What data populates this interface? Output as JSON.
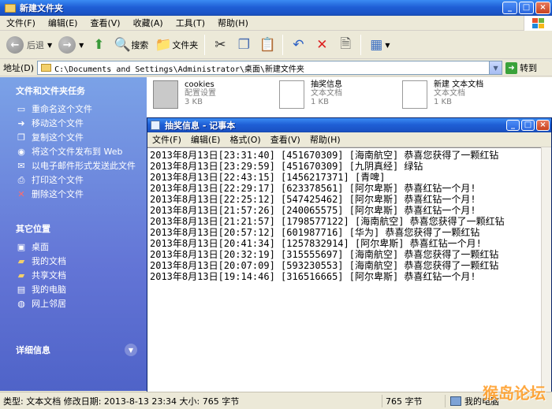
{
  "explorer": {
    "title": "新建文件夹",
    "menu": [
      "文件(F)",
      "编辑(E)",
      "查看(V)",
      "收藏(A)",
      "工具(T)",
      "帮助(H)"
    ],
    "toolbar": {
      "back": "后退",
      "search": "搜索",
      "folders": "文件夹"
    },
    "address": {
      "label": "地址(D)",
      "path": "C:\\Documents and Settings\\Administrator\\桌面\\新建文件夹",
      "go": "转到"
    }
  },
  "taskpane": {
    "file_tasks_title": "文件和文件夹任务",
    "file_tasks": [
      {
        "label": "重命名这个文件",
        "icon": "rename-icon"
      },
      {
        "label": "移动这个文件",
        "icon": "move-icon"
      },
      {
        "label": "复制这个文件",
        "icon": "copy-icon"
      },
      {
        "label": "将这个文件发布到 Web",
        "icon": "publish-icon"
      },
      {
        "label": "以电子邮件形式发送此文件",
        "icon": "email-icon"
      },
      {
        "label": "打印这个文件",
        "icon": "print-icon"
      },
      {
        "label": "删除这个文件",
        "icon": "delete-icon"
      }
    ],
    "other_places_title": "其它位置",
    "other_places": [
      {
        "label": "桌面",
        "icon": "desktop-icon"
      },
      {
        "label": "我的文档",
        "icon": "my-documents-icon"
      },
      {
        "label": "共享文档",
        "icon": "shared-documents-icon"
      },
      {
        "label": "我的电脑",
        "icon": "my-computer-icon"
      },
      {
        "label": "网上邻居",
        "icon": "network-icon"
      }
    ],
    "details_title": "详细信息"
  },
  "files": [
    {
      "name": "cookies",
      "type": "配置设置",
      "size": "3 KB",
      "icon": "config-file-icon"
    },
    {
      "name": "抽奖信息",
      "type": "文本文档",
      "size": "1 KB",
      "icon": "text-file-icon"
    },
    {
      "name": "新建 文本文档",
      "type": "文本文档",
      "size": "1 KB",
      "icon": "text-file-icon"
    }
  ],
  "notepad": {
    "title": "抽奖信息 - 记事本",
    "menu": [
      "文件(F)",
      "编辑(E)",
      "格式(O)",
      "查看(V)",
      "帮助(H)"
    ],
    "lines": [
      "2013年8月13日[23:31:40] [451670309] [海南航空] 恭喜您获得了一颗红钻",
      "2013年8月13日[23:29:59] [451670309] [九阴真经] 绿钻",
      "2013年8月13日[22:43:15] [1456217371] [青啤]",
      "2013年8月13日[22:29:17] [623378561] [阿尔卑斯] 恭喜红钻一个月!",
      "2013年8月13日[22:25:12] [547425462] [阿尔卑斯] 恭喜红钻一个月!",
      "2013年8月13日[21:57:26] [240065575] [阿尔卑斯] 恭喜红钻一个月!",
      "2013年8月13日[21:21:57] [1798577122] [海南航空] 恭喜您获得了一颗红钻",
      "2013年8月13日[20:57:12] [601987716] [华为] 恭喜您获得了一颗红钻",
      "2013年8月13日[20:41:34] [1257832914] [阿尔卑斯] 恭喜红钻一个月!",
      "2013年8月13日[20:32:19] [315555697] [海南航空] 恭喜您获得了一颗红钻",
      "2013年8月13日[20:07:09] [593230553] [海南航空] 恭喜您获得了一颗红钻",
      "2013年8月13日[19:14:46] [316516665] [阿尔卑斯] 恭喜红钻一个月!"
    ]
  },
  "status": {
    "left": "类型: 文本文档 修改日期: 2013-8-13 23:34 大小: 765 字节",
    "size": "765 字节",
    "location": "我的电脑"
  },
  "watermark": "猴岛论坛"
}
